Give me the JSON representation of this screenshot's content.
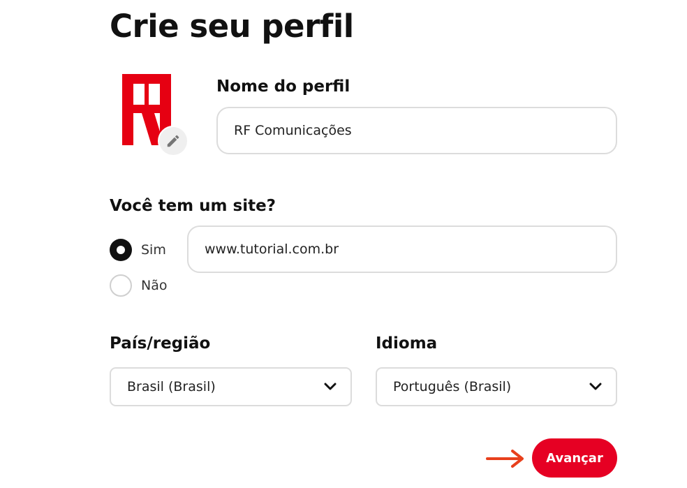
{
  "page": {
    "title": "Crie seu perfil"
  },
  "profile": {
    "avatar_icon": "brand-logo-icon",
    "edit_icon": "pencil-icon",
    "name_label": "Nome do perfil",
    "name_value": "RF Comunicações"
  },
  "website": {
    "question": "Você tem um site?",
    "options": [
      {
        "label": "Sim",
        "selected": true
      },
      {
        "label": "Não",
        "selected": false
      }
    ],
    "url_value": "www.tutorial.com.br"
  },
  "region": {
    "label": "País/região",
    "value": "Brasil (Brasil)",
    "icon": "chevron-down-icon"
  },
  "language": {
    "label": "Idioma",
    "value": "Português (Brasil)",
    "icon": "chevron-down-icon"
  },
  "actions": {
    "next_label": "Avançar",
    "pointer_icon": "arrow-right-icon"
  },
  "colors": {
    "accent": "#e60023",
    "arrow": "#e8401c",
    "logo": "#e60012"
  }
}
